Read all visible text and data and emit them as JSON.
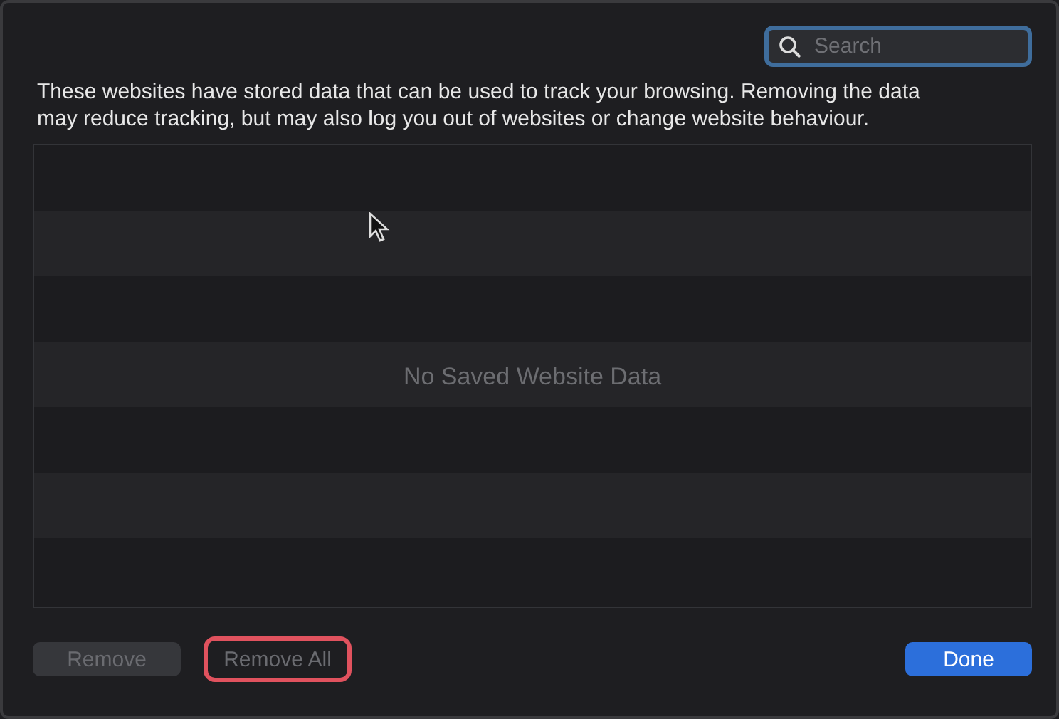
{
  "search": {
    "placeholder": "Search"
  },
  "description": "These websites have stored data that can be used to track your browsing. Removing the data may reduce tracking, but may also log you out of websites or change website behaviour.",
  "table": {
    "empty_message": "No Saved Website Data"
  },
  "buttons": [
    {
      "label": "Remove",
      "kind": "secondary",
      "disabled": true,
      "highlighted": false
    },
    {
      "label": "Remove All",
      "kind": "plain",
      "disabled": true,
      "highlighted": true
    },
    {
      "label": "Done",
      "kind": "primary",
      "disabled": false,
      "highlighted": false
    }
  ]
}
